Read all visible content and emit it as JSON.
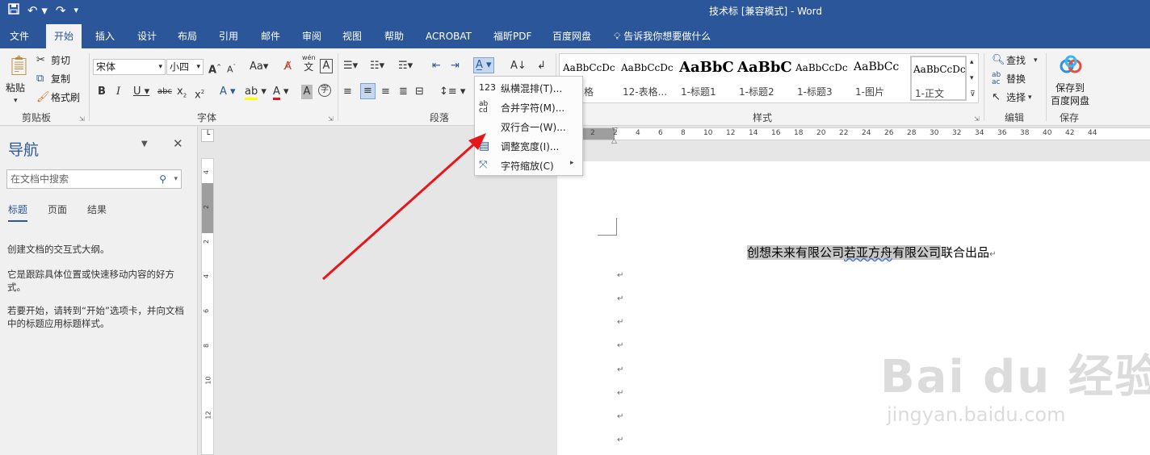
{
  "titlebar": {
    "title": "技术标 [兼容模式]  -  Word",
    "save_icon": "save-icon",
    "undo_icon": "undo-icon",
    "redo_icon": "redo-icon"
  },
  "menu": {
    "tabs": [
      "文件",
      "开始",
      "插入",
      "设计",
      "布局",
      "引用",
      "邮件",
      "审阅",
      "视图",
      "帮助",
      "ACROBAT",
      "福昕PDF",
      "百度网盘"
    ],
    "tell_me": "告诉我你想要做什么"
  },
  "ribbon": {
    "clipboard": {
      "paste": "粘贴",
      "cut": "剪切",
      "copy": "复制",
      "format_painter": "格式刷",
      "label": "剪贴板"
    },
    "font": {
      "font_name": "宋体",
      "font_size": "小四",
      "label": "字体",
      "wen": "wén",
      "pinyin_char": "文"
    },
    "paragraph": {
      "label": "段落"
    },
    "styles": {
      "items": [
        {
          "sample": "AaBbCcDc",
          "name": "1-表格"
        },
        {
          "sample": "AaBbCcDc",
          "name": "12-表格..."
        },
        {
          "sample": "AaBbC",
          "name": "1-标题1"
        },
        {
          "sample": "AaBbC",
          "name": "1-标题2"
        },
        {
          "sample": "AaBbCcDc",
          "name": "1-标题3"
        },
        {
          "sample": "AaBbCc",
          "name": "1-图片"
        },
        {
          "sample": "AaBbCcDc",
          "name": "1-正文"
        }
      ],
      "label": "样式"
    },
    "editing": {
      "find": "查找",
      "replace": "替换",
      "select": "选择",
      "label": "编辑"
    },
    "save": {
      "line1": "保存到",
      "line2": "百度网盘",
      "label": "保存"
    }
  },
  "dropdown": {
    "items": [
      {
        "label": "纵横混排(T)...",
        "icon": "123"
      },
      {
        "label": "合并字符(M)...",
        "icon": "ab cd"
      },
      {
        "label": "双行合一(W)...",
        "icon": ""
      },
      {
        "label": "调整宽度(I)...",
        "icon": ""
      },
      {
        "label": "字符缩放(C)",
        "icon": ""
      }
    ]
  },
  "nav": {
    "title": "导航",
    "search_placeholder": "在文档中搜索",
    "tabs": [
      "标题",
      "页面",
      "结果"
    ],
    "text1": "创建文档的交互式大纲。",
    "text2": "它是跟踪具体位置或快速移动内容的好方式。",
    "text3": "若要开始，请转到“开始”选项卡，并向文档中的标题应用标题样式。"
  },
  "ruler": {
    "h_numbers": [
      "2",
      "2",
      "4",
      "6",
      "8",
      "10",
      "12",
      "14",
      "16",
      "18",
      "20",
      "22",
      "24",
      "26",
      "28",
      "30",
      "32",
      "34",
      "36",
      "38",
      "40",
      "42",
      "44"
    ],
    "v_numbers": [
      "4",
      "2",
      "2",
      "4",
      "6",
      "8",
      "10",
      "12"
    ]
  },
  "document": {
    "hl_text1": "创想未来有限公司",
    "hl_text2": "若亚方舟",
    "hl_text3": "有限公司",
    "plain_text": "联合出品",
    "para_mark": "↵"
  },
  "watermark": {
    "brand": "Bai du 经验",
    "url": "jingyan.baidu.com"
  },
  "colors": {
    "accent": "#2b579a",
    "arrow": "#e8161b"
  }
}
